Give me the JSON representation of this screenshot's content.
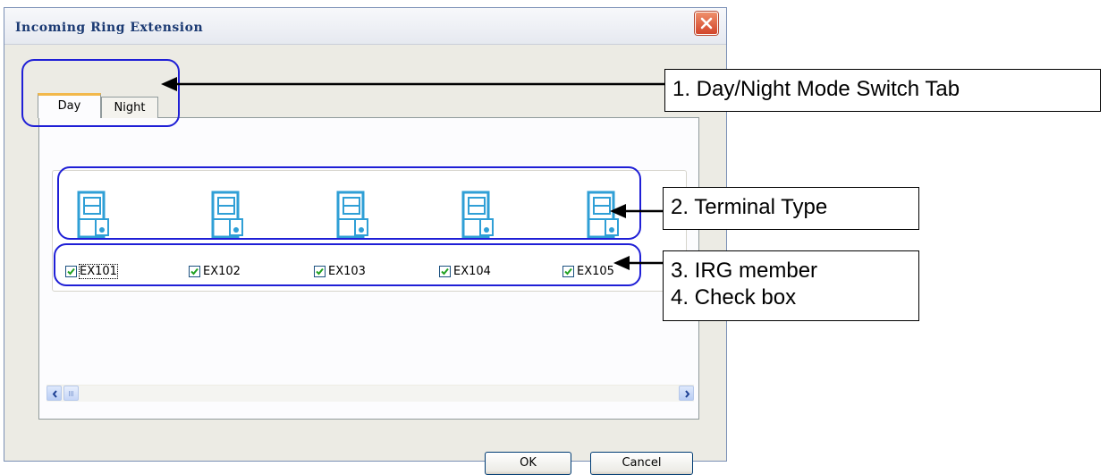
{
  "dialog": {
    "title": "Incoming Ring Extension",
    "close_icon": "close-icon"
  },
  "tabs": [
    {
      "label": "Day",
      "selected": true
    },
    {
      "label": "Night",
      "selected": false
    }
  ],
  "members": [
    {
      "label": "EX101",
      "checked": true,
      "terminal_icon": "terminal-icon",
      "focused": true
    },
    {
      "label": "EX102",
      "checked": true,
      "terminal_icon": "terminal-icon",
      "focused": false
    },
    {
      "label": "EX103",
      "checked": true,
      "terminal_icon": "terminal-icon",
      "focused": false
    },
    {
      "label": "EX104",
      "checked": true,
      "terminal_icon": "terminal-icon",
      "focused": false
    },
    {
      "label": "EX105",
      "checked": true,
      "terminal_icon": "terminal-icon",
      "focused": false
    }
  ],
  "buttons": {
    "ok": "OK",
    "cancel": "Cancel"
  },
  "annotations": [
    {
      "lines": [
        "1. Day/Night Mode Switch Tab"
      ]
    },
    {
      "lines": [
        "2. Terminal Type"
      ]
    },
    {
      "lines": [
        "3. IRG member",
        "4. Check box"
      ]
    }
  ],
  "colors": {
    "highlight": "#1f1fd6",
    "accent_tab": "#f2b84b",
    "terminal_icon": "#2f9fd6"
  }
}
